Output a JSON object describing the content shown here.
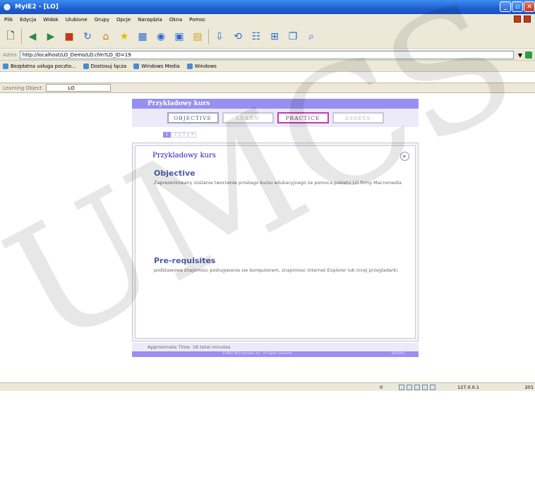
{
  "window": {
    "title": "MyIE2 - [LO]"
  },
  "menu": [
    "Plik",
    "Edycja",
    "Widok",
    "Ulubione",
    "Grupy",
    "Opcje",
    "Narzędzia",
    "Okna",
    "Pomoc"
  ],
  "address": {
    "label": "Adres",
    "url": "http://localhost/LO_Demo/LO.cfm?LO_ID=19"
  },
  "links": [
    "Bezpłatna usługa poczto...",
    "Dostosuj łącza",
    "Windows Media",
    "Windows"
  ],
  "lo_bar": {
    "label": "Learning Object",
    "value": "LO"
  },
  "course": {
    "header": "Przykladowy kurs",
    "nav": [
      "OBJECTIVE",
      "LEARN",
      "PRACTICE",
      "ASSESS"
    ],
    "pager": [
      "1",
      "2",
      "3",
      "4"
    ],
    "title": "Przykladowy kurs",
    "objective_heading": "Objective",
    "objective_text": "Zaprezentowany zostanie tworzenie prostego kursu edukacyjnego za pomoca pakietu LO firmy Macromedia",
    "prereq_heading": "Pre-requisites",
    "prereq_text": "podstawowa znajomosc poslugiwania sie komputerem, znajomosc Internet Explorer lub innej przegladarki.",
    "time": "Approximate Time: 18 total minutes",
    "copyright": "©2002 Macromedia, Inc. All rights reserved.",
    "relogo": "RELOAD"
  },
  "status": {
    "count": "0",
    "ip": "127.0.0.1",
    "year": "201"
  },
  "watermark": "UMCS"
}
